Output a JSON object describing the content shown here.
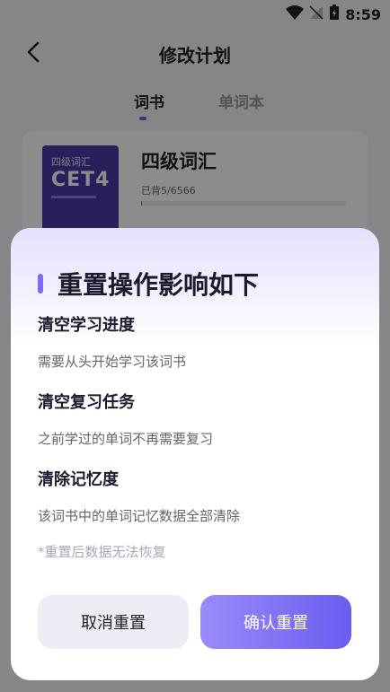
{
  "statusbar": {
    "time": "8:59"
  },
  "header": {
    "title": "修改计划"
  },
  "tabs": [
    {
      "label": "词书"
    },
    {
      "label": "单词本"
    }
  ],
  "book": {
    "cover_small": "四级词汇",
    "cover_big": "CET4",
    "name": "四级词汇",
    "progress_text": "已背5/6566",
    "progress_fraction": 0.0008
  },
  "dialog": {
    "title": "重置操作影响如下",
    "items": [
      {
        "title": "清空学习进度",
        "desc": "需要从头开始学习该词书"
      },
      {
        "title": "清空复习任务",
        "desc": "之前学过的单词不再需要复习"
      },
      {
        "title": "清除记忆度",
        "desc": "该词书中的单词记忆数据全部清除"
      }
    ],
    "note": "*重置后数据无法恢复",
    "cancel_label": "取消重置",
    "confirm_label": "确认重置"
  },
  "colors": {
    "accent": "#6b5cf2"
  }
}
